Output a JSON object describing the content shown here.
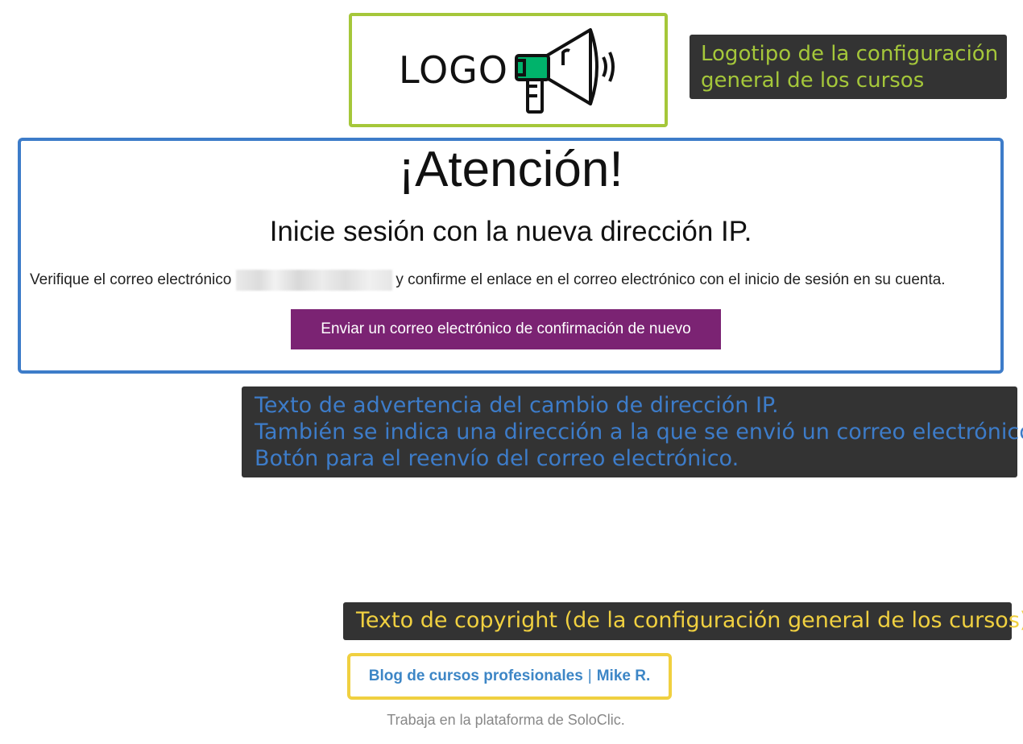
{
  "logo": {
    "text": "LOGO",
    "icon": "megaphone-icon",
    "colors": {
      "accent": "#00b36b",
      "frame": "#a5c73a"
    }
  },
  "annotations": {
    "logo_callout": [
      "Logotipo de la configuración",
      "general de los cursos"
    ],
    "warning_callout": [
      "Texto de advertencia del cambio de dirección IP.",
      "También se indica una dirección a la que se envió un correo electrónico.",
      "Botón para el reenvío del correo electrónico."
    ],
    "copyright_callout": "Texto de copyright (de la configuración general de los cursos).",
    "colors": {
      "logo": "#a5c73a",
      "warning": "#3d7cc9",
      "copyright": "#f0d040",
      "background": "#333333"
    }
  },
  "notice": {
    "title": "¡Atención!",
    "subtitle": "Inicie sesión con la nueva dirección IP.",
    "verify_prefix": "Verifique el correo electrónico",
    "verify_suffix": "y confirme el enlace en el correo electrónico con el inicio de sesión en su cuenta.",
    "resend_button": "Enviar un correo electrónico de confirmación de nuevo",
    "button_color": "#7b2373"
  },
  "footer": {
    "blog_link": "Blog de cursos profesionales",
    "separator": "|",
    "author_link": "Mike R.",
    "platform_text": "Trabaja en la plataforma de SoloClic."
  }
}
